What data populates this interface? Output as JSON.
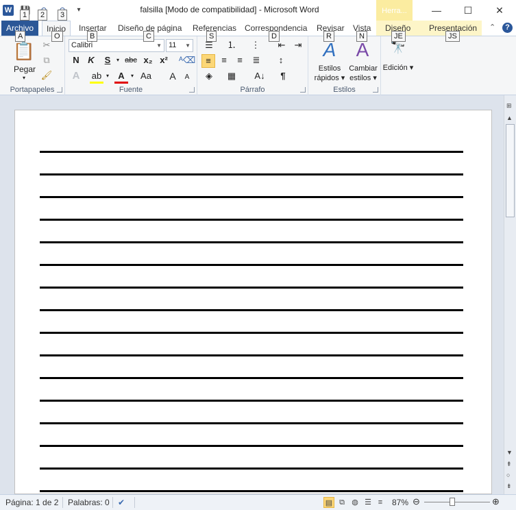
{
  "window": {
    "title": "falsilla [Modo de compatibilidad]  -  Microsoft Word",
    "app_icon": "W",
    "context_tab_header": "Herra...",
    "controls": {
      "minimize": "—",
      "maximize": "☐",
      "close": "✕"
    }
  },
  "qat": {
    "save": "💾",
    "undo": "↶",
    "redo": "↷",
    "customize": "▾"
  },
  "tabs": {
    "file": "Archivo",
    "items": [
      "Inicio",
      "Insertar",
      "Diseño de página",
      "Referencias",
      "Correspondencia",
      "Revisar",
      "Vista",
      "Diseño",
      "Presentación"
    ]
  },
  "keytips": {
    "qat1": "1",
    "qat2": "2",
    "qat3": "3",
    "file": "A",
    "inicio": "O",
    "insertar": "B",
    "diseno_pagina": "C",
    "referencias": "S",
    "correspondencia": "D",
    "revisar": "R",
    "vista": "N",
    "diseno": "JE",
    "presentacion": "JS"
  },
  "ribbon": {
    "clipboard": {
      "label": "Portapapeles",
      "paste": "Pegar"
    },
    "font": {
      "label": "Fuente",
      "font_name": "Calibri",
      "font_size": "11",
      "bold": "N",
      "italic": "K",
      "underline": "S",
      "strike": "abc",
      "subscript": "x₂",
      "superscript": "x²",
      "grow": "A",
      "shrink": "A",
      "case": "Aa",
      "clear": "A"
    },
    "paragraph": {
      "label": "Párrafo",
      "pilcrow": "¶"
    },
    "styles": {
      "label": "Estilos",
      "quick_styles_1": "Estilos",
      "quick_styles_2": "rápidos ▾",
      "change_styles_1": "Cambiar",
      "change_styles_2": "estilos ▾"
    },
    "editing": {
      "label": "Edición ▾"
    }
  },
  "document": {
    "ruled_lines": 16
  },
  "status": {
    "page": "Página: 1 de 2",
    "words": "Palabras: 0",
    "zoom": "87%",
    "zoom_level_percent": 87
  },
  "colors": {
    "file_tab": "#2b5797",
    "context_header": "#fbeca0",
    "selection": "#fcd777"
  }
}
